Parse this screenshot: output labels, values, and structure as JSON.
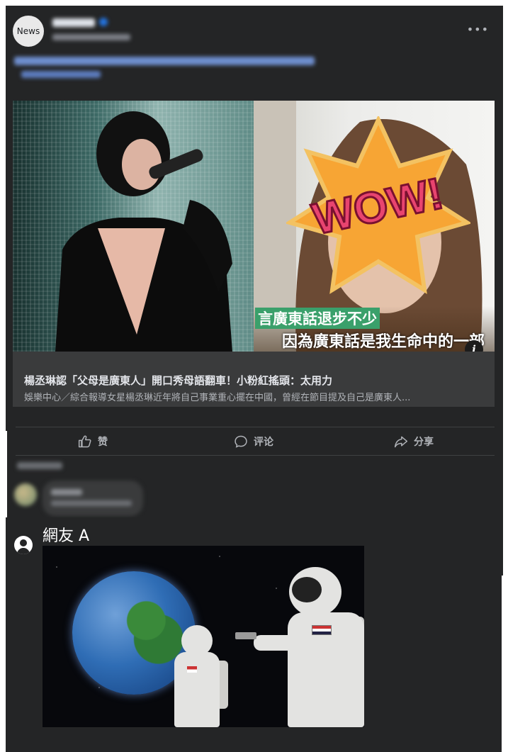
{
  "post": {
    "page_avatar_text": "News",
    "image_captions": {
      "line1": "言廣東話退步不少",
      "line2": "因為廣東話是我生命中的一部"
    },
    "overlay_badge": "WOW!",
    "link": {
      "title": "楊丞琳認「父母是廣東人」開口秀母語翻車！小粉紅搖頭：太用力",
      "description": "娛樂中心／綜合報導女星楊丞琳近年將自己事業重心擺在中國，曾經在節目提及自己是廣東人..."
    }
  },
  "actions": {
    "like_label": "赞",
    "comment_label": "评论",
    "share_label": "分享"
  },
  "reply": {
    "name": "網友 A"
  },
  "colors": {
    "card_bg": "#242526",
    "link_meta_bg": "#3a3b3c",
    "text_primary": "#e4e6eb",
    "text_secondary": "#b0b3b8",
    "caption_green": "#3aa06b",
    "wow_orange": "#f7a534",
    "wow_pink": "#e8446f"
  },
  "icons": [
    "more-icon",
    "verified-icon",
    "info-icon",
    "like-icon",
    "comment-icon",
    "share-icon",
    "user-icon"
  ]
}
